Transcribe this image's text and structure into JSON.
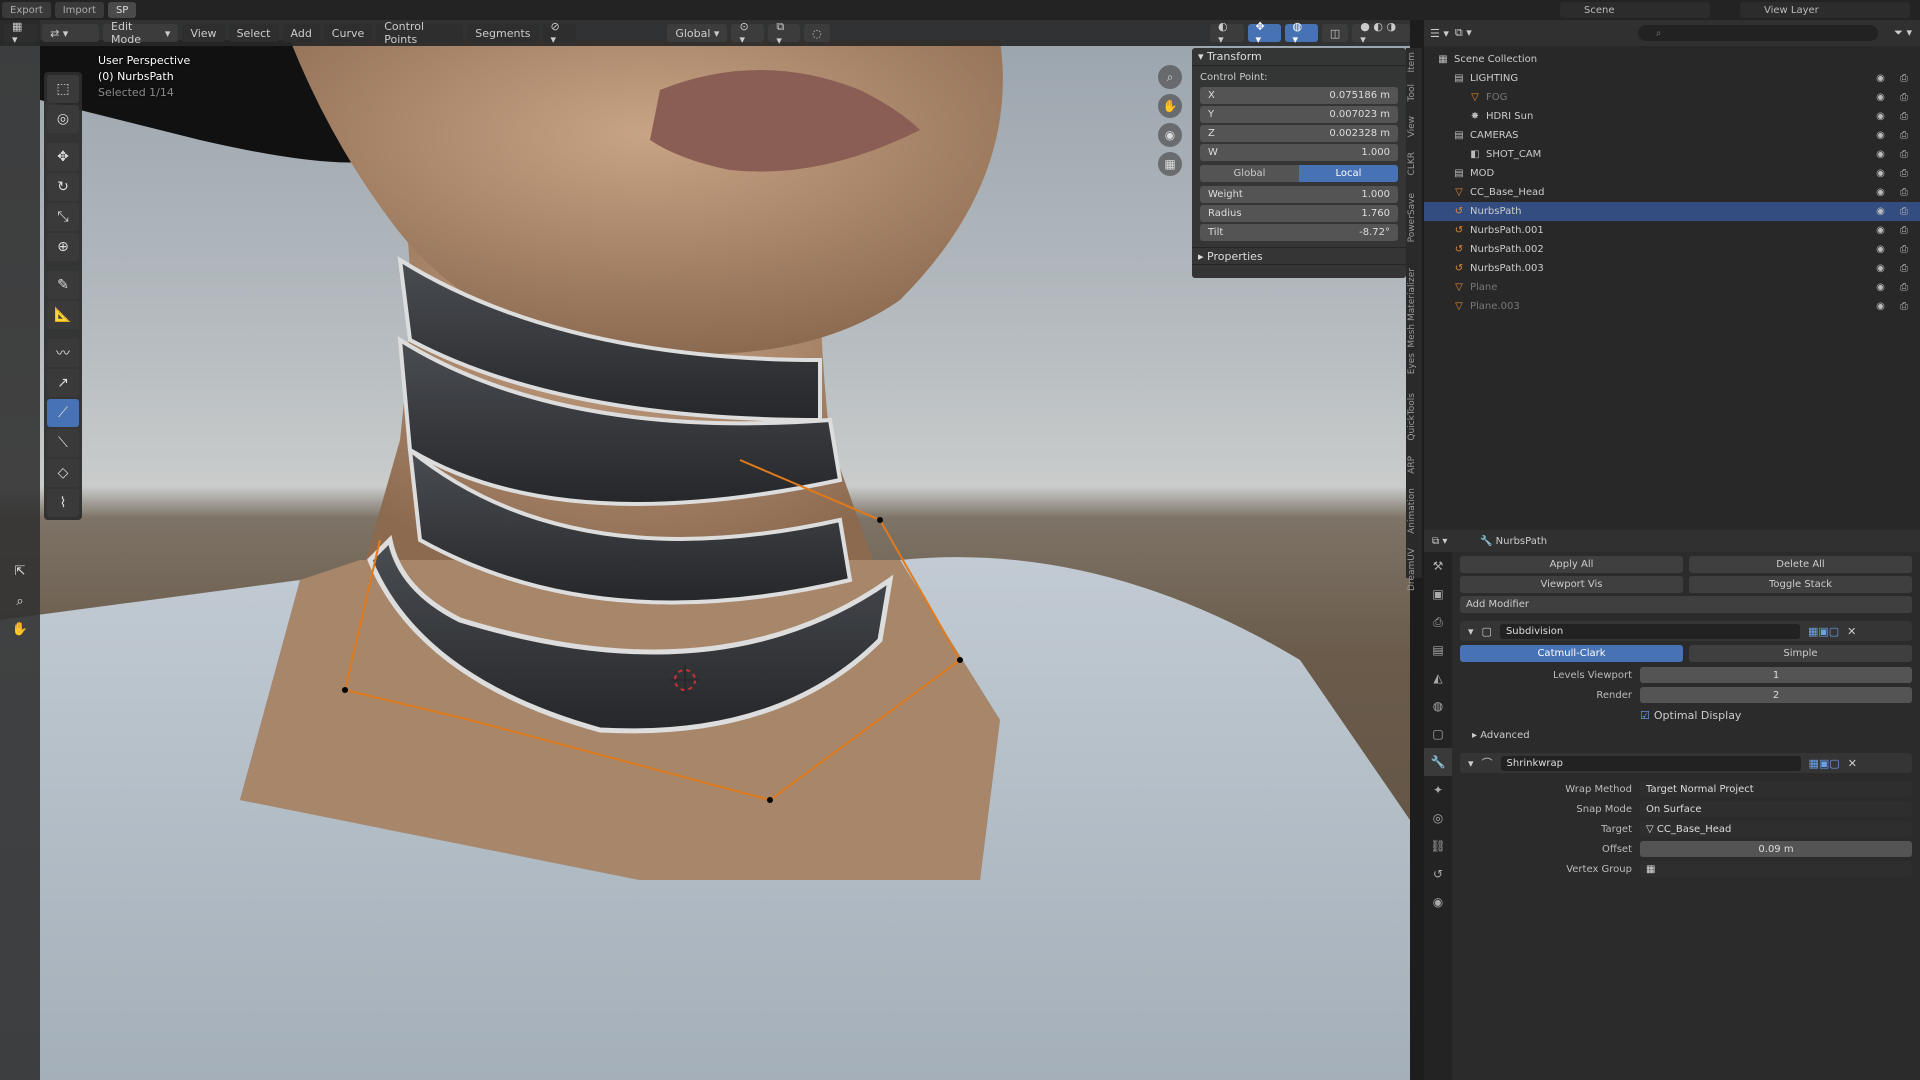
{
  "topbar": {
    "tabs": [
      "Export",
      "Import",
      "SP"
    ],
    "scene": "Scene",
    "view_layer": "View Layer"
  },
  "viewport": {
    "header": {
      "mode": "Edit Mode",
      "menus": [
        "View",
        "Select",
        "Add",
        "Curve",
        "Control Points",
        "Segments"
      ],
      "orientation": "Global"
    },
    "overlay": {
      "perspective": "User Perspective",
      "object": "(0) NurbsPath",
      "stats": "Selected 1/14"
    }
  },
  "npanel": {
    "transform_title": "Transform",
    "control_point_label": "Control Point:",
    "fields": [
      {
        "key": "X",
        "value": "0.075186 m"
      },
      {
        "key": "Y",
        "value": "0.007023 m"
      },
      {
        "key": "Z",
        "value": "0.002328 m"
      },
      {
        "key": "W",
        "value": "1.000"
      }
    ],
    "space_options": [
      "Global",
      "Local"
    ],
    "space_selected": "Local",
    "fields2": [
      {
        "key": "Weight",
        "value": "1.000"
      },
      {
        "key": "Radius",
        "value": "1.760"
      },
      {
        "key": "Tilt",
        "value": "-8.72°"
      }
    ],
    "properties_title": "Properties",
    "side_tabs": [
      "Item",
      "Tool",
      "View",
      "CLKR",
      "PowerSave",
      "Mesh Materializer",
      "Eyes",
      "QuickTools",
      "ARP",
      "Animation",
      "DreamUV"
    ]
  },
  "outliner": {
    "search_placeholder": "",
    "rows": [
      {
        "label": "Scene Collection",
        "indent": 0,
        "icon": "▦",
        "dim": false,
        "sel": false
      },
      {
        "label": "LIGHTING",
        "indent": 1,
        "icon": "▤",
        "dim": false,
        "sel": false
      },
      {
        "label": "FOG",
        "indent": 2,
        "icon": "▽",
        "dim": true,
        "sel": false
      },
      {
        "label": "HDRI Sun",
        "indent": 2,
        "icon": "✸",
        "dim": false,
        "sel": false
      },
      {
        "label": "CAMERAS",
        "indent": 1,
        "icon": "▤",
        "dim": false,
        "sel": false
      },
      {
        "label": "SHOT_CAM",
        "indent": 2,
        "icon": "◧",
        "dim": false,
        "sel": false
      },
      {
        "label": "MOD",
        "indent": 1,
        "icon": "▤",
        "dim": false,
        "sel": false
      },
      {
        "label": "CC_Base_Head",
        "indent": 1,
        "icon": "▽",
        "dim": false,
        "sel": false
      },
      {
        "label": "NurbsPath",
        "indent": 1,
        "icon": "↺",
        "dim": false,
        "sel": true
      },
      {
        "label": "NurbsPath.001",
        "indent": 1,
        "icon": "↺",
        "dim": false,
        "sel": false
      },
      {
        "label": "NurbsPath.002",
        "indent": 1,
        "icon": "↺",
        "dim": false,
        "sel": false
      },
      {
        "label": "NurbsPath.003",
        "indent": 1,
        "icon": "↺",
        "dim": false,
        "sel": false
      },
      {
        "label": "Plane",
        "indent": 1,
        "icon": "▽",
        "dim": true,
        "sel": false
      },
      {
        "label": "Plane.003",
        "indent": 1,
        "icon": "▽",
        "dim": true,
        "sel": false
      }
    ]
  },
  "properties": {
    "object_name": "NurbsPath",
    "apply_all": "Apply All",
    "delete_all": "Delete All",
    "viewport_vis": "Viewport Vis",
    "toggle_stack": "Toggle Stack",
    "add_modifier": "Add Modifier",
    "subdivision": {
      "name": "Subdivision",
      "modes": [
        "Catmull-Clark",
        "Simple"
      ],
      "mode_selected": "Catmull-Clark",
      "levels_viewport_label": "Levels Viewport",
      "levels_viewport": "1",
      "render_label": "Render",
      "render": "2",
      "optimal_display": "Optimal Display",
      "advanced": "Advanced"
    },
    "shrinkwrap": {
      "name": "Shrinkwrap",
      "wrap_method_label": "Wrap Method",
      "wrap_method": "Target Normal Project",
      "snap_mode_label": "Snap Mode",
      "snap_mode": "On Surface",
      "target_label": "Target",
      "target": "CC_Base_Head",
      "offset_label": "Offset",
      "offset": "0.09 m",
      "vertex_group_label": "Vertex Group",
      "vertex_group": ""
    }
  },
  "colors": {
    "accent": "#4772b3",
    "curve": "#e07a1a",
    "selected_row": "#334d80"
  }
}
